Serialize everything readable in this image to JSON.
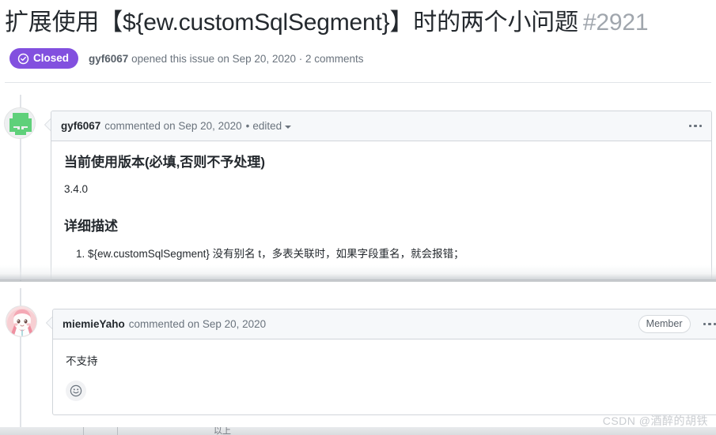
{
  "issue": {
    "title": "扩展使用【${ew.customSqlSegment}】时的两个小问题",
    "number": "#2921",
    "state_label": "Closed",
    "state_icon": "check-circle-icon",
    "state_color": "#8250df",
    "meta_author": "gyf6067",
    "meta_text": " opened this issue on Sep 20, 2020 · 2 comments"
  },
  "comments": [
    {
      "author": "gyf6067",
      "avatar_icon": "identicon-avatar",
      "avatar_color": "#5fd07a",
      "timestamp": "commented on Sep 20, 2020",
      "separator": "•",
      "edited_label": "edited",
      "edited_caret_icon": "chevron-down-icon",
      "menu_icon": "kebab-menu-icon",
      "heading_1": "当前使用版本(必填,否则不予处理)",
      "version": "3.4.0",
      "heading_2": "详细描述",
      "list_items": [
        "${ew.customSqlSegment} 没有别名 t，多表关联时，如果字段重名，就会报错；"
      ]
    },
    {
      "author": "miemieYaho",
      "avatar_icon": "anime-avatar",
      "avatar_color": "#f4b9bd",
      "timestamp": "commented on Sep 20, 2020",
      "role_badge": "Member",
      "menu_icon": "kebab-menu-icon",
      "text": "不支持",
      "reaction_icon": "smiley-add-reaction-icon"
    }
  ],
  "watermark": "CSDN @酒醉的胡铁"
}
